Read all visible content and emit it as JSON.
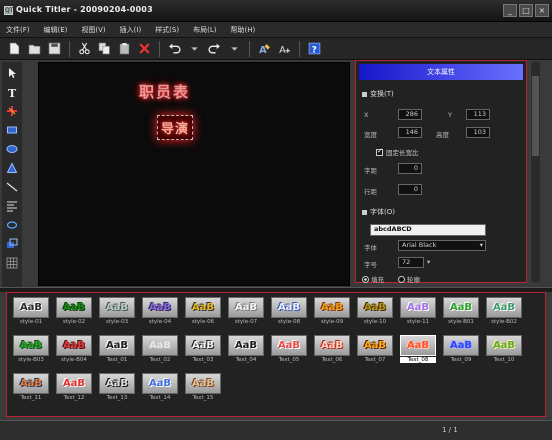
{
  "window": {
    "title": "Quick Titler - 20090204-0003",
    "app_icon": "QT"
  },
  "window_controls": {
    "minimize": "_",
    "maximize": "□",
    "close": "×"
  },
  "menu": [
    {
      "label": "文件(F)"
    },
    {
      "label": "编辑(E)"
    },
    {
      "label": "视图(V)"
    },
    {
      "label": "插入(I)"
    },
    {
      "label": "样式(S)"
    },
    {
      "label": "布局(L)"
    },
    {
      "label": "帮助(H)"
    }
  ],
  "canvas": {
    "title_text": "职员表",
    "subtitle_text": "导演"
  },
  "panel": {
    "header": "文本属性",
    "transform_section": "变换(T)",
    "x_label": "X",
    "x_value": "286",
    "y_label": "Y",
    "y_value": "113",
    "width_label": "宽度",
    "width_value": "146",
    "height_label": "高度",
    "height_value": "103",
    "lock_ratio_label": "固定长宽比",
    "char_spacing_label": "字距",
    "char_spacing_value": "0",
    "line_spacing_label": "行距",
    "line_spacing_value": "0",
    "font_section": "字体(O)",
    "font_preview": "abcdABCD",
    "font_label": "字体",
    "font_value": "Arial Black",
    "size_label": "字号",
    "size_value": "72",
    "radio_1": "填充",
    "radio_2": "轮廓"
  },
  "styles": [
    {
      "caption": "style-01",
      "color": "#2a2a2a",
      "shadow": "#ffffff"
    },
    {
      "caption": "style-02",
      "color": "#1a8a1a",
      "shadow": "#0a3a0a"
    },
    {
      "caption": "style-03",
      "color": "#c0c8d8",
      "shadow": "#406040"
    },
    {
      "caption": "style-04",
      "color": "#8a6ad8",
      "shadow": "#302060"
    },
    {
      "caption": "style-06",
      "color": "#e8b820",
      "shadow": "#303030"
    },
    {
      "caption": "style-07",
      "color": "#f4f4f4",
      "shadow": "#7a7a7a"
    },
    {
      "caption": "style-08",
      "color": "#eef2ff",
      "shadow": "#3a5aa8"
    },
    {
      "caption": "style-09",
      "color": "#f0a020",
      "shadow": "#803000"
    },
    {
      "caption": "style-10",
      "color": "#b89020",
      "shadow": "#403000"
    },
    {
      "caption": "style-11",
      "color": "#a070e8",
      "shadow": "#ffffff"
    },
    {
      "caption": "style-B01",
      "color": "#2aa02a",
      "shadow": "#ffffff"
    },
    {
      "caption": "style-B02",
      "color": "#3a9a6a",
      "shadow": "#ffffff"
    },
    {
      "caption": "style-B03",
      "color": "#28a828",
      "shadow": "#1a4a1a"
    },
    {
      "caption": "style-B04",
      "color": "#d84040",
      "shadow": "#501010"
    },
    {
      "caption": "Text_01",
      "color": "#1a1a1a",
      "shadow": "#ffffff"
    },
    {
      "caption": "Text_02",
      "color": "#e8e8e8",
      "shadow": "#bbbbbb"
    },
    {
      "caption": "Text_03",
      "color": "#f4f4f4",
      "shadow": "#222222"
    },
    {
      "caption": "Text_04",
      "color": "#1a1a1a",
      "shadow": "#ffffff"
    },
    {
      "caption": "Text_05",
      "color": "#e84848",
      "shadow": "#ffffff"
    },
    {
      "caption": "Text_06",
      "color": "#ffd8c0",
      "shadow": "#c02020"
    },
    {
      "caption": "Text_07",
      "color": "#f8b020",
      "shadow": "#602000"
    },
    {
      "caption": "Text_08",
      "color": "#ff5030",
      "shadow": "#ffd0c0"
    },
    {
      "caption": "Text_09",
      "color": "#3040f8",
      "shadow": "#a0b0ff"
    },
    {
      "caption": "Text_10",
      "color": "#60a830",
      "shadow": "#f8f0a0"
    },
    {
      "caption": "Text_11",
      "color": "#e88030",
      "shadow": "#203060"
    },
    {
      "caption": "Text_12",
      "color": "#e03030",
      "shadow": "#ffffff"
    },
    {
      "caption": "Text_13",
      "color": "#e0e0e0",
      "shadow": "#101010"
    },
    {
      "caption": "Text_14",
      "color": "#4070e0",
      "shadow": "#ffffff"
    },
    {
      "caption": "Text_15",
      "color": "#d8c8a0",
      "shadow": "#804020"
    }
  ],
  "style_sample": "AaB",
  "selected_style": "Text_08",
  "status": {
    "page": "1 / 1"
  }
}
